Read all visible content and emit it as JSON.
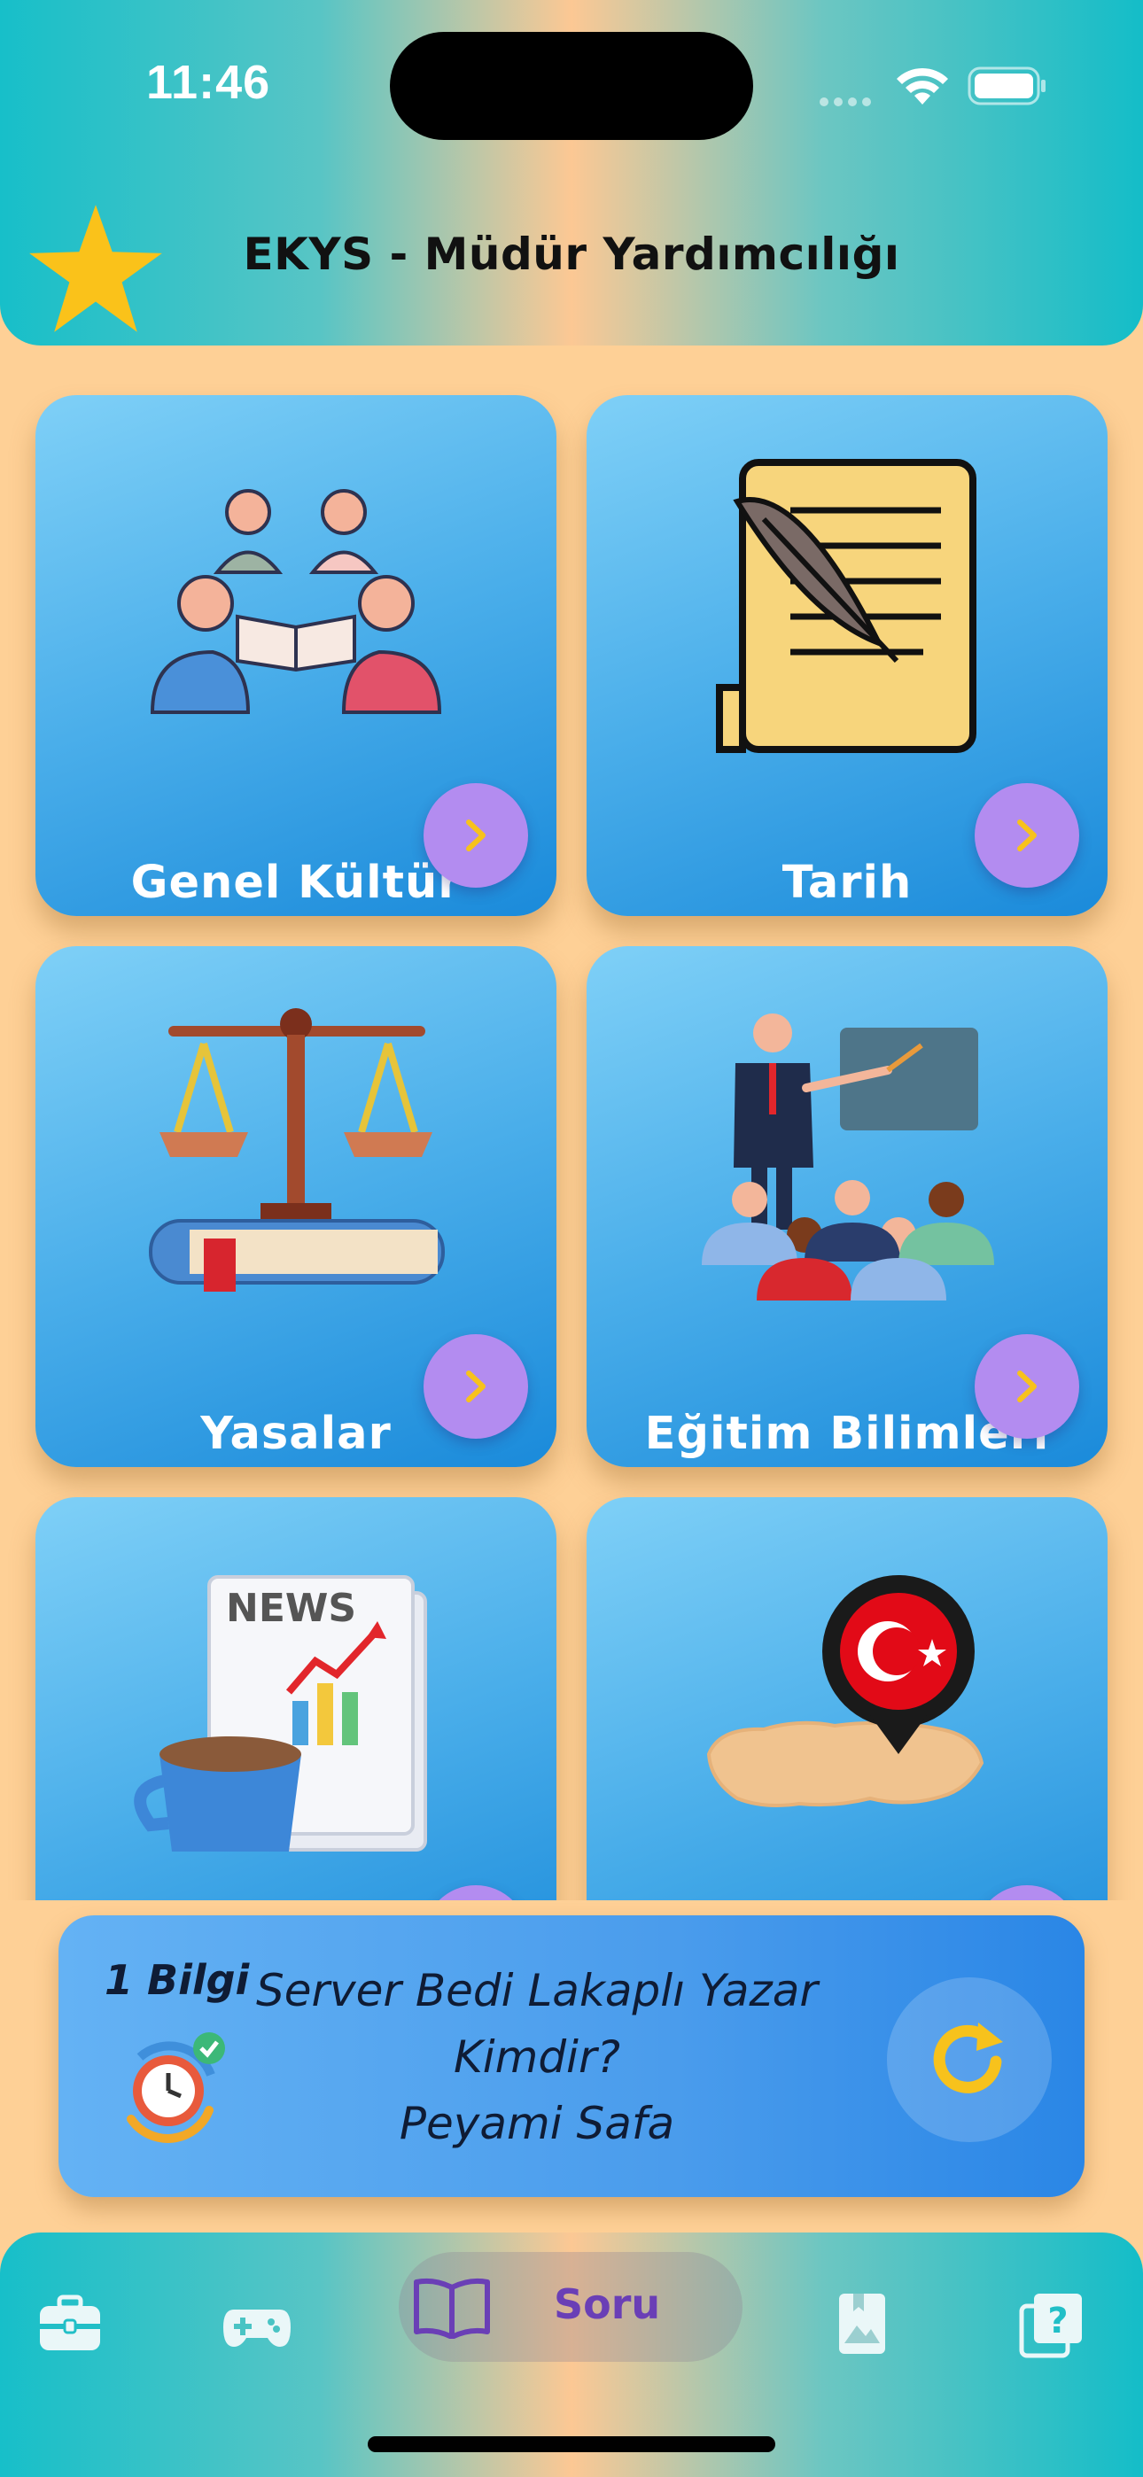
{
  "status_bar": {
    "time": "11:46"
  },
  "header": {
    "title": "EKYS - Müdür Yardımcılığı",
    "icon": "star-icon"
  },
  "colors": {
    "background": "#FED096",
    "card_start": "#7FD0F7",
    "card_end": "#1A8ADA",
    "go_button": "#B38CF0",
    "accent_yellow": "#F7C21C",
    "active_tab_text": "#6A3FB6"
  },
  "categories": [
    {
      "label": "Genel Kültür",
      "icon": "reading-group-icon"
    },
    {
      "label": "Tarih",
      "icon": "scroll-quill-icon"
    },
    {
      "label": "Yasalar",
      "icon": "scales-book-icon"
    },
    {
      "label": "Eğitim Bilimleri",
      "icon": "teacher-class-icon"
    },
    {
      "label": "",
      "icon": "news-coffee-icon"
    },
    {
      "label": "",
      "icon": "turkey-map-pin-icon"
    }
  ],
  "info_card": {
    "count": "1 Bilgi",
    "question_line1": "Server Bedi Lakaplı Yazar",
    "question_line2": "Kimdir?",
    "answer": "Peyami Safa",
    "icon": "clock-check-icon",
    "refresh_icon": "refresh-icon"
  },
  "tabbar": {
    "items": [
      {
        "icon": "briefcase-icon"
      },
      {
        "icon": "gamepad-icon"
      },
      {
        "icon": "open-book-icon",
        "label": "Soru",
        "active": true
      },
      {
        "icon": "bookmark-photo-icon"
      },
      {
        "icon": "question-cards-icon"
      }
    ]
  }
}
